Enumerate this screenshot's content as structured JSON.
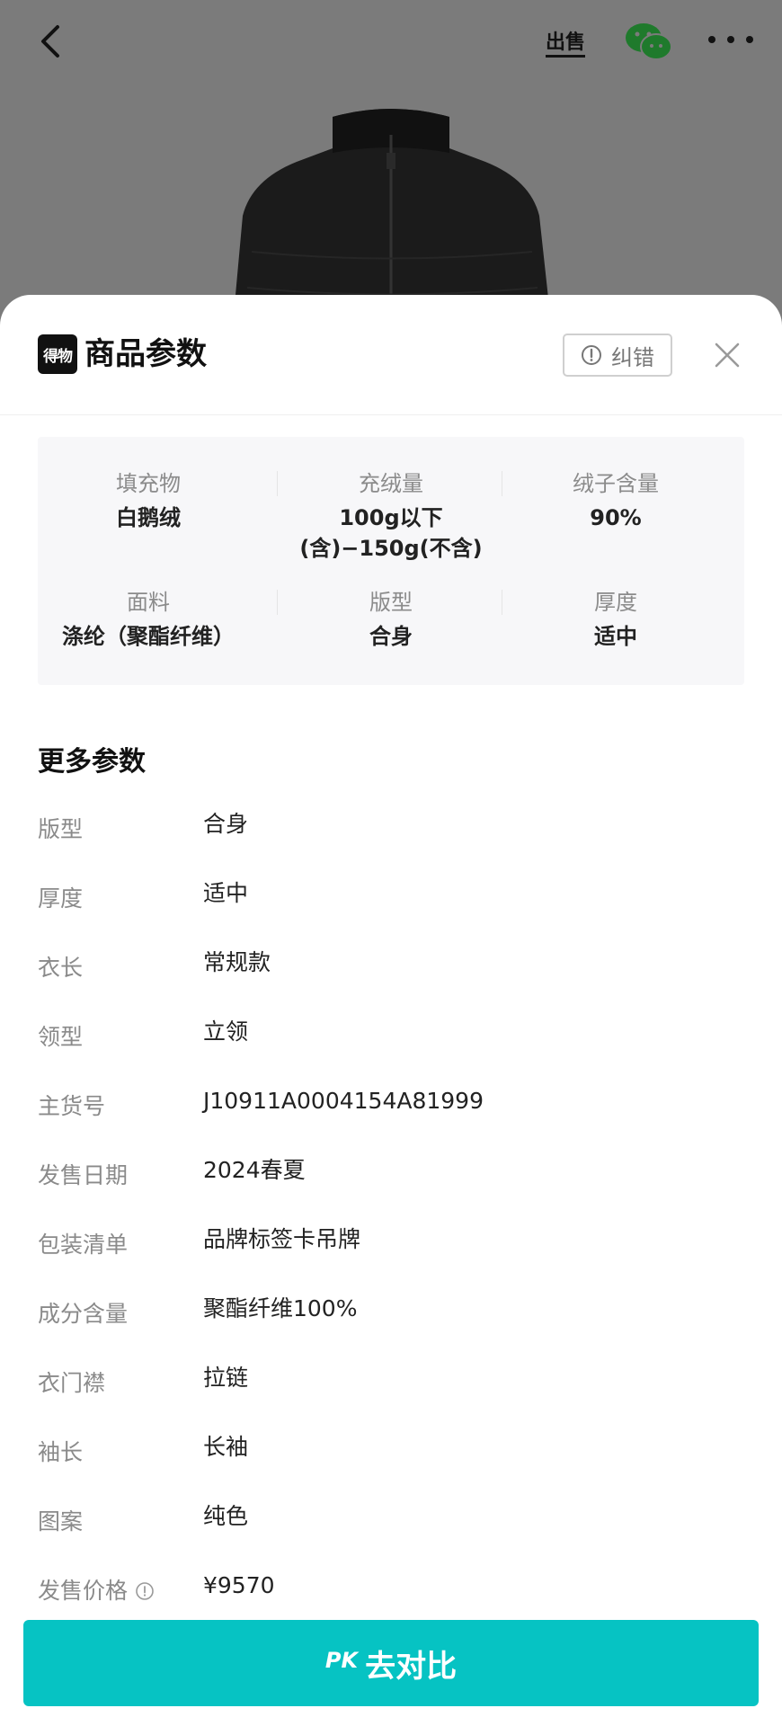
{
  "topbar": {
    "back_icon": "chevron-left-icon",
    "sell_label": "出售",
    "wechat_icon": "wechat-icon",
    "more_icon": "more-horizontal-icon"
  },
  "sheet": {
    "logo_text": "得物",
    "title": "商品参数",
    "correct_button_label": "纠错",
    "close_icon": "close-icon"
  },
  "summary": [
    {
      "label": "填充物",
      "value": "白鹅绒"
    },
    {
      "label": "充绒量",
      "value": "100g以下",
      "value2": "(含)−150g(不含)"
    },
    {
      "label": "绒子含量",
      "value": "90%"
    },
    {
      "label": "面料",
      "value": "涤纶（聚酯纤维）"
    },
    {
      "label": "版型",
      "value": "合身"
    },
    {
      "label": "厚度",
      "value": "适中"
    }
  ],
  "more": {
    "title": "更多参数",
    "rows": [
      {
        "label": "版型",
        "value": "合身"
      },
      {
        "label": "厚度",
        "value": "适中"
      },
      {
        "label": "衣长",
        "value": "常规款"
      },
      {
        "label": "领型",
        "value": "立领"
      },
      {
        "label": "主货号",
        "value": "J10911A0004154A81999"
      },
      {
        "label": "发售日期",
        "value": "2024春夏"
      },
      {
        "label": "包装清单",
        "value": "品牌标签卡吊牌"
      },
      {
        "label": "成分含量",
        "value": "聚酯纤维100%"
      },
      {
        "label": "衣门襟",
        "value": "拉链"
      },
      {
        "label": "袖长",
        "value": "长袖"
      },
      {
        "label": "图案",
        "value": "纯色"
      },
      {
        "label": "发售价格",
        "value": "¥9570",
        "has_info": true
      }
    ]
  },
  "pk_button": {
    "tag": "PK",
    "label": "去对比"
  },
  "colors": {
    "accent": "#06c3c3",
    "overlay": "#7b7b7b",
    "text_primary": "#222222",
    "text_secondary": "#8a8a8a"
  }
}
